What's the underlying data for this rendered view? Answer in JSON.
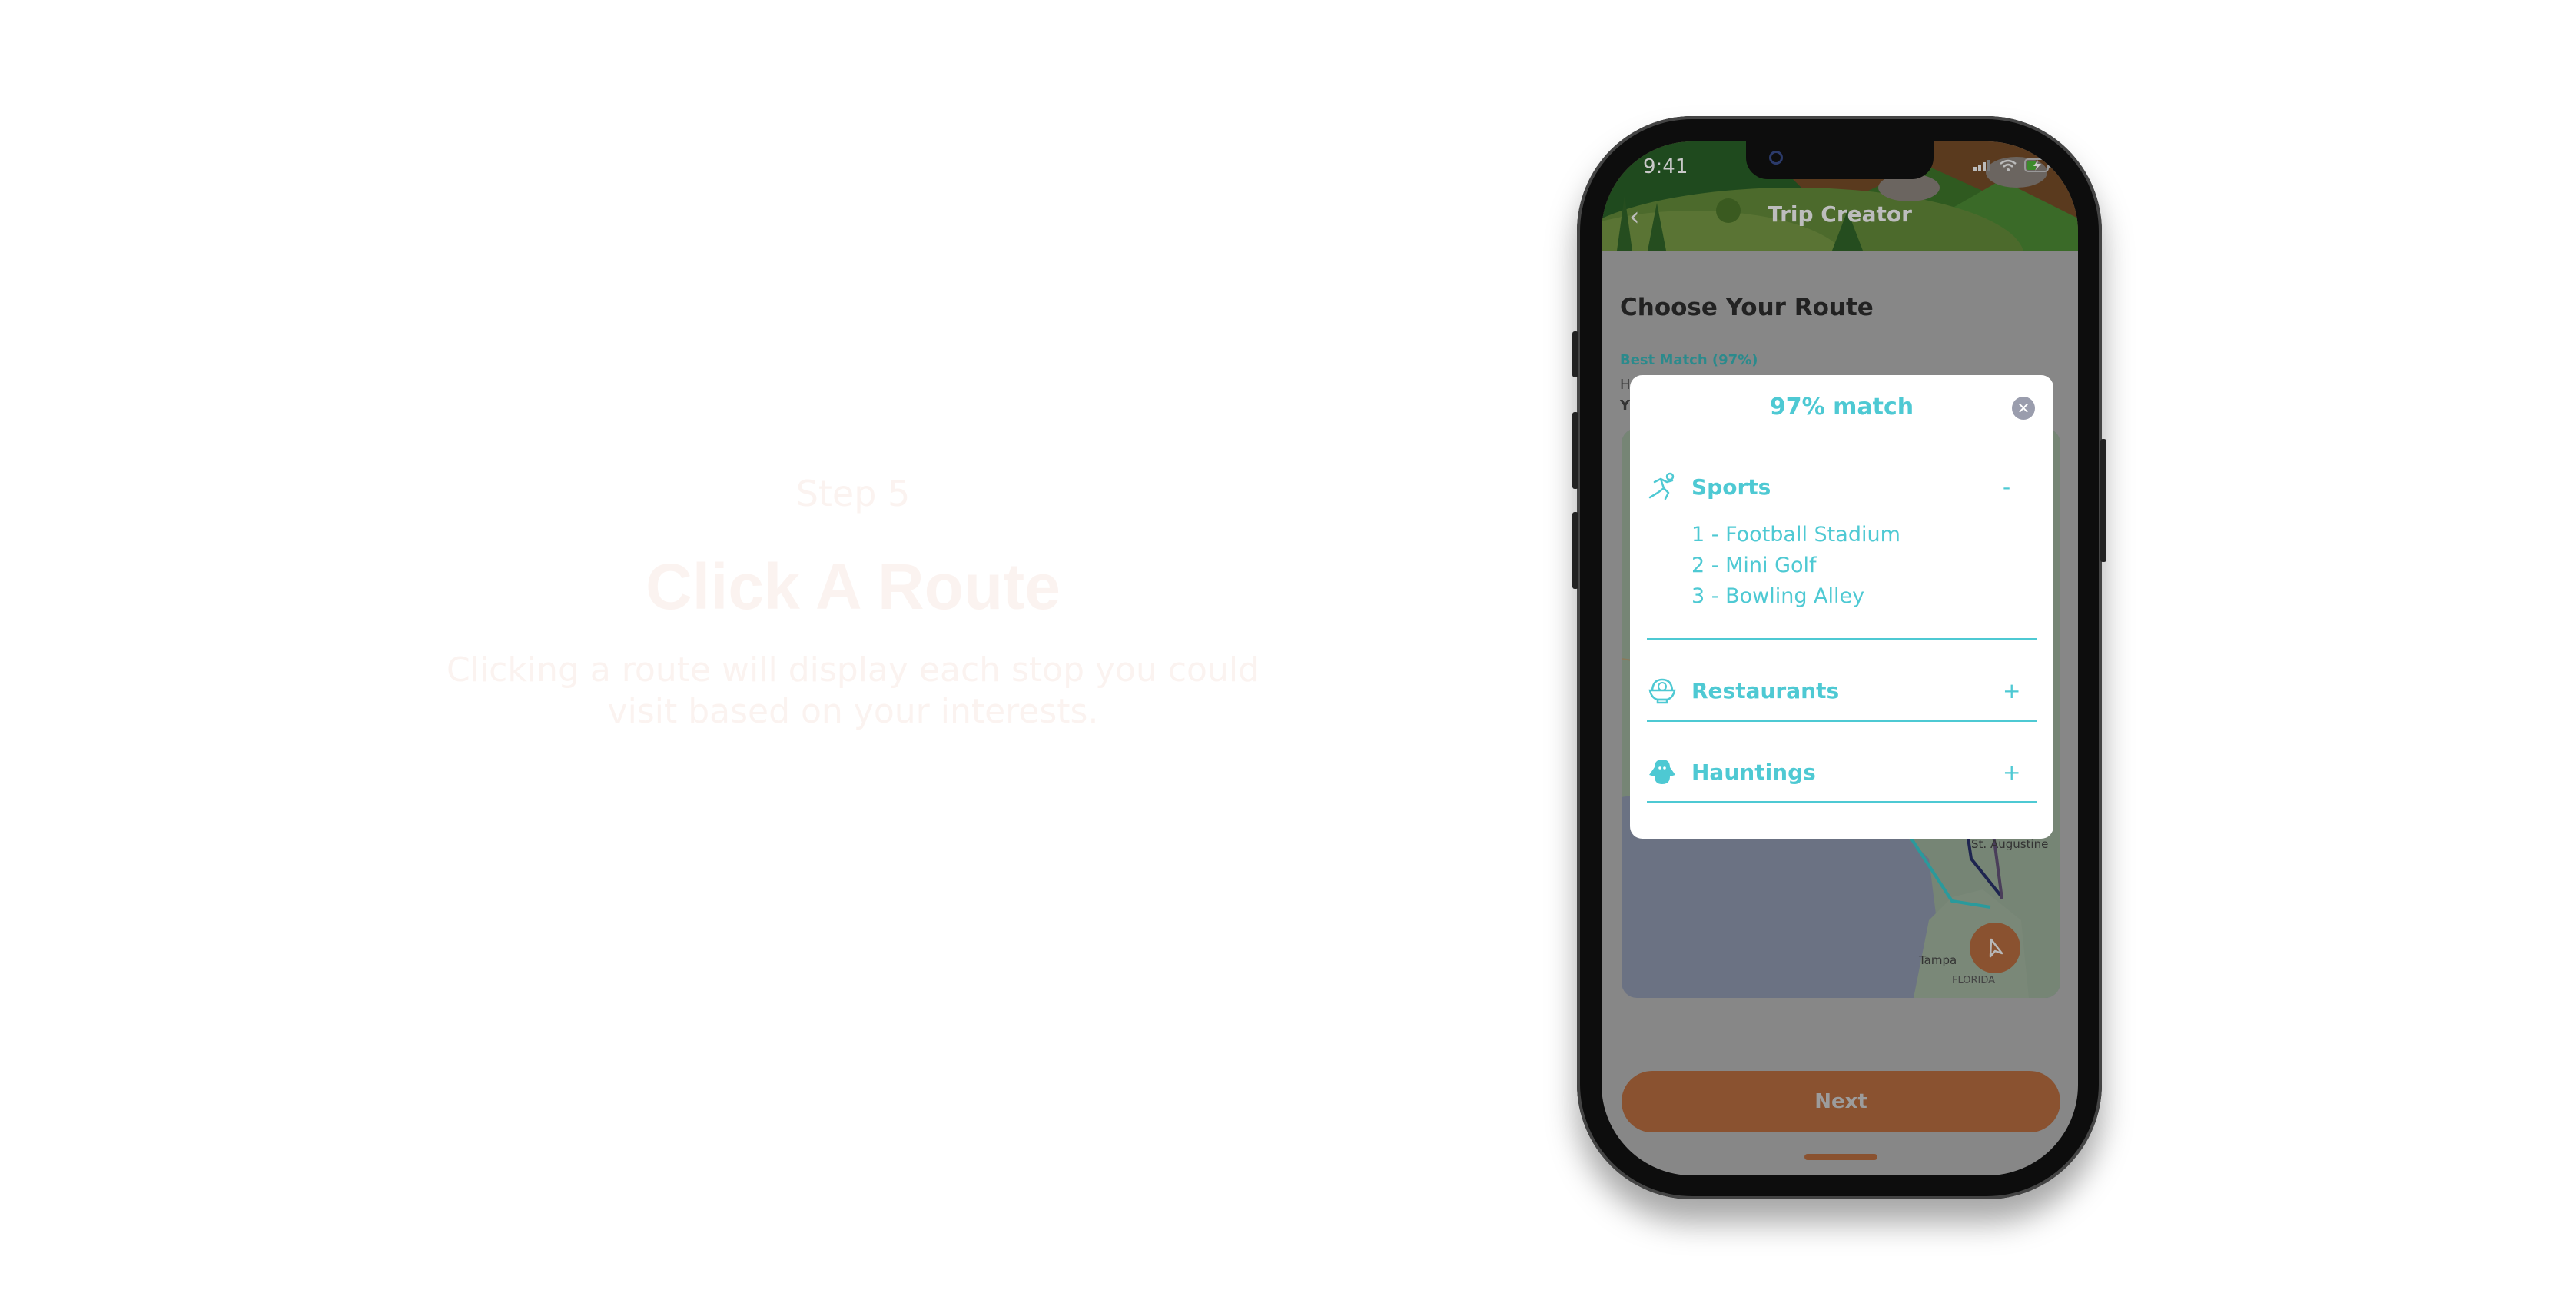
{
  "intro": {
    "step": "Step 5",
    "headline": "Click A Route",
    "description_line1": "Clicking a route will display each stop you could",
    "description_line2": "visit based on your interests."
  },
  "phone": {
    "status_bar": {
      "time": "9:41",
      "icons": [
        "signal-icon",
        "wifi-icon",
        "battery-charging-icon"
      ]
    },
    "header": {
      "title": "Trip Creator",
      "back_icon": "chevron-left-icon"
    },
    "page_title": "Choose Your Route",
    "best_match_label": "Best Match (97%)",
    "partial_line1": "H",
    "partial_line2": "Y",
    "map": {
      "labels": [
        "St. Augustine",
        "Tampa",
        "FLORIDA"
      ],
      "navigate_icon": "navigation-arrow-icon"
    },
    "next_label": "Next"
  },
  "modal": {
    "title": "97% match",
    "close_icon": "close-icon",
    "categories": [
      {
        "label": "Sports",
        "icon": "running-person-icon",
        "toggle": "-",
        "expanded": true,
        "items": [
          "1 - Football Stadium",
          "2 - Mini Golf",
          "3 - Bowling Alley"
        ]
      },
      {
        "label": "Restaurants",
        "icon": "food-bowl-icon",
        "toggle": "+",
        "expanded": false
      },
      {
        "label": "Hauntings",
        "icon": "ghost-icon",
        "toggle": "+",
        "expanded": false
      }
    ]
  },
  "colors": {
    "accent": "#4ec9d3",
    "button": "#d9783f",
    "intro_text": "#fbf3f0"
  }
}
